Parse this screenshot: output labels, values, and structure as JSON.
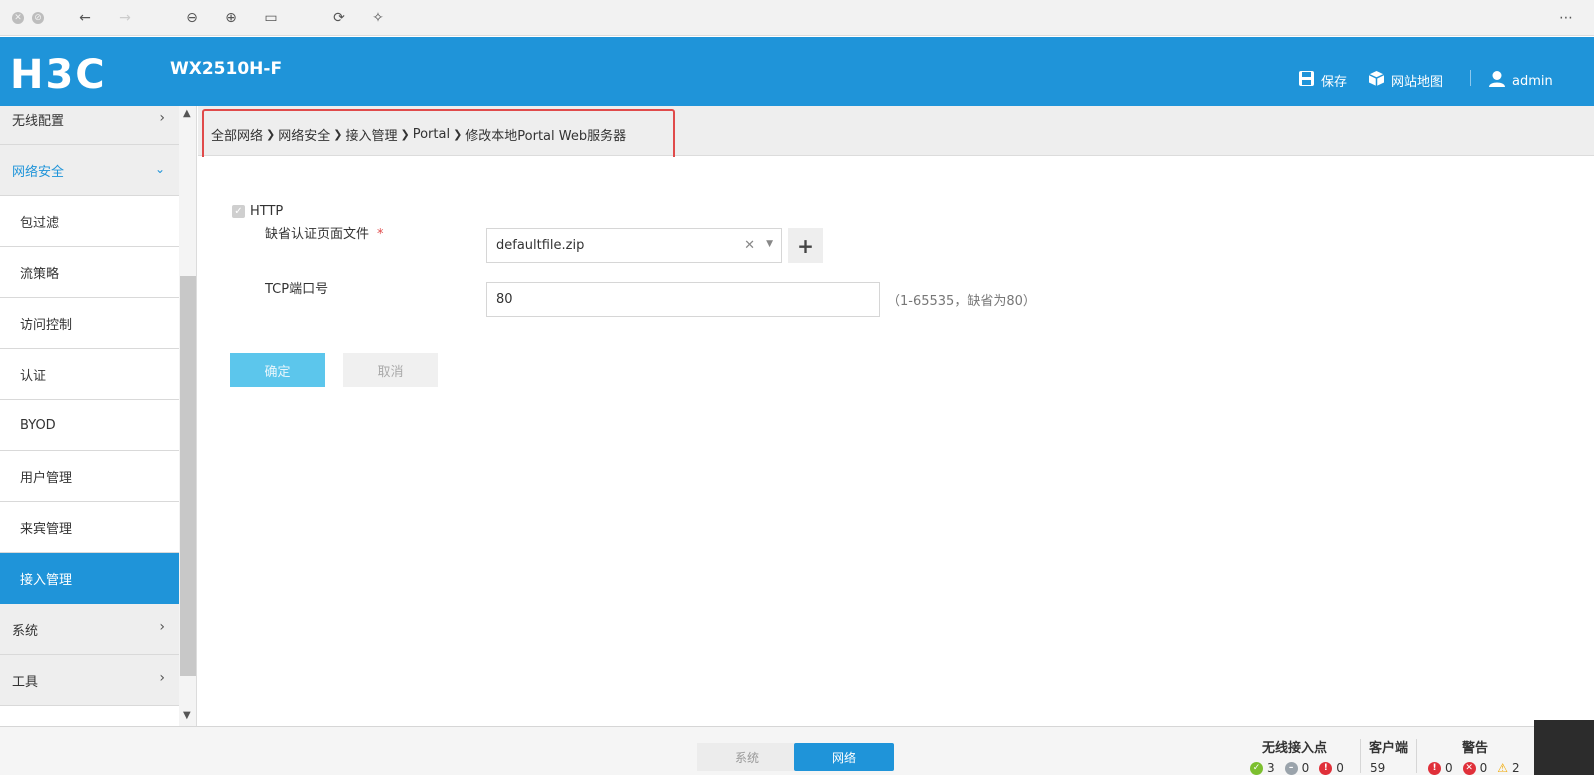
{
  "header": {
    "brand": "H3C",
    "model": "WX2510H-F",
    "save_label": "保存",
    "sitemap_label": "网站地图",
    "user_label": "admin"
  },
  "sidebar": {
    "items": [
      {
        "label": "无线配置"
      },
      {
        "label": "网络安全"
      },
      {
        "label": "包过滤"
      },
      {
        "label": "流策略"
      },
      {
        "label": "访问控制"
      },
      {
        "label": "认证"
      },
      {
        "label": "BYOD"
      },
      {
        "label": "用户管理"
      },
      {
        "label": "来宾管理"
      },
      {
        "label": "接入管理"
      },
      {
        "label": "系统"
      },
      {
        "label": "工具"
      }
    ]
  },
  "breadcrumb": {
    "items": [
      "全部网络",
      "网络安全",
      "接入管理",
      "Portal",
      "修改本地Portal Web服务器"
    ]
  },
  "form": {
    "http_label": "HTTP",
    "http_checked": true,
    "default_file_label": "缺省认证页面文件",
    "required_mark": "*",
    "default_file_value": "defaultfile.zip",
    "tcp_port_label": "TCP端口号",
    "tcp_port_value": "80",
    "tcp_port_hint": "（1-65535，缺省为80）",
    "ok_label": "确定",
    "cancel_label": "取消"
  },
  "footer": {
    "tab_system": "系统",
    "tab_network": "网络",
    "ap_title": "无线接入点",
    "ap_ok": "3",
    "ap_offline": "0",
    "ap_error": "0",
    "clients_title": "客户端",
    "clients_count": "59",
    "alarm_title": "警告",
    "alarm_critical": "0",
    "alarm_major": "0",
    "alarm_warning": "2"
  },
  "colors": {
    "brand_blue": "#1f94d9",
    "highlight_red": "#e04a4a"
  }
}
